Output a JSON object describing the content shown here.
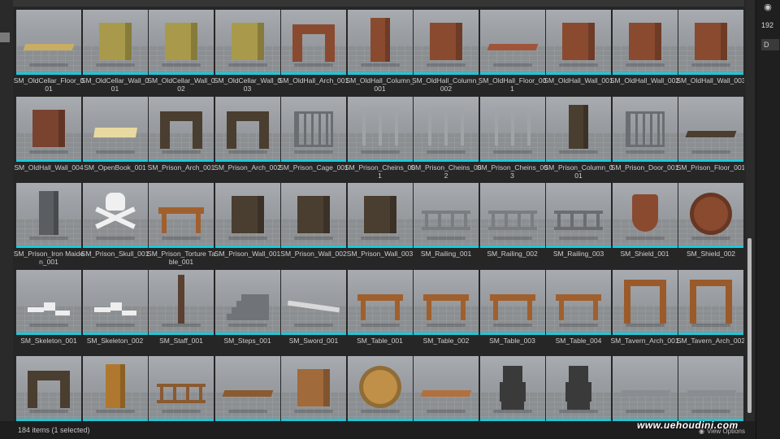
{
  "status": {
    "item_count": "184 items (1 selected)",
    "view_options": "View Options",
    "watermark": "www.uehoudini.com"
  },
  "side_panel": {
    "number": "192",
    "doc_label": "D",
    "visibility_icon": "eye-icon"
  },
  "colors": {
    "accent_cyan": "#19c9d9",
    "panel_bg": "#262626",
    "thumb_bg": "#9a9ea2"
  },
  "assets": [
    {
      "label": "SM_OldCellar_Floor_001",
      "kind": "floor",
      "color": "#c9ad63"
    },
    {
      "label": "SM_OldCellar_Wall_001",
      "kind": "block",
      "color": "#a89a4a"
    },
    {
      "label": "SM_OldCellar_Wall_002",
      "kind": "block",
      "color": "#a89a4a"
    },
    {
      "label": "SM_OldCellar_Wall_003",
      "kind": "block",
      "color": "#a89a4a"
    },
    {
      "label": "SM_OldHall_Arch_001",
      "kind": "arch",
      "color": "#8a4a30"
    },
    {
      "label": "SM_OldHall_Column_001",
      "kind": "column",
      "color": "#8a4a30"
    },
    {
      "label": "SM_OldHall_Column_002",
      "kind": "block",
      "color": "#8a4a30"
    },
    {
      "label": "SM_OldHall_Floor_001",
      "kind": "floor",
      "color": "#a0553a"
    },
    {
      "label": "SM_OldHall_Wall_001",
      "kind": "block",
      "color": "#8a4a30"
    },
    {
      "label": "SM_OldHall_Wall_002",
      "kind": "block",
      "color": "#8a4a30"
    },
    {
      "label": "SM_OldHall_Wall_003",
      "kind": "block",
      "color": "#8a4a30"
    },
    {
      "label": "SM_OldHall_Wall_004",
      "kind": "block",
      "color": "#7a4330"
    },
    {
      "label": "SM_OpenBook_001",
      "kind": "flat",
      "color": "#e8d9a0"
    },
    {
      "label": "SM_Prison_Arch_001",
      "kind": "arch",
      "color": "#4a3e30"
    },
    {
      "label": "SM_Prison_Arch_002",
      "kind": "arch",
      "color": "#4a3e30"
    },
    {
      "label": "SM_Prison_Cage_001",
      "kind": "cage",
      "color": "#6a6e72"
    },
    {
      "label": "SM_Prison_Cheins_001",
      "kind": "chains",
      "color": "#a0a4a8"
    },
    {
      "label": "SM_Prison_Cheins_002",
      "kind": "chains",
      "color": "#a0a4a8"
    },
    {
      "label": "SM_Prison_Cheins_003",
      "kind": "chains",
      "color": "#a0a4a8"
    },
    {
      "label": "SM_Prison_Column_001",
      "kind": "column",
      "color": "#4a3e30"
    },
    {
      "label": "SM_Prison_Door_001",
      "kind": "cage",
      "color": "#6a6e72"
    },
    {
      "label": "SM_Prison_Floor_001",
      "kind": "floor",
      "color": "#4a3e30"
    },
    {
      "label": "SM_Prison_Iron Maiden_001",
      "kind": "column",
      "color": "#5a5e62"
    },
    {
      "label": "SM_Prison_Skull_001",
      "kind": "skull",
      "color": "#f0f0f0"
    },
    {
      "label": "SM_Prison_Torture Table_001",
      "kind": "table",
      "color": "#a0602e"
    },
    {
      "label": "SM_Prison_Wall_001",
      "kind": "block",
      "color": "#4a3e30"
    },
    {
      "label": "SM_Prison_Wall_002",
      "kind": "block",
      "color": "#4a3e30"
    },
    {
      "label": "SM_Prison_Wall_003",
      "kind": "block",
      "color": "#4a3e30"
    },
    {
      "label": "SM_Railing_001",
      "kind": "railing",
      "color": "#7a7e82"
    },
    {
      "label": "SM_Railing_002",
      "kind": "railing",
      "color": "#7a7e82"
    },
    {
      "label": "SM_Railing_003",
      "kind": "railing",
      "color": "#6a6e72"
    },
    {
      "label": "SM_Shield_001",
      "kind": "shield",
      "color": "#8a4a30"
    },
    {
      "label": "SM_Shield_002",
      "kind": "round",
      "color": "#8a4a30"
    },
    {
      "label": "SM_Skeleton_001",
      "kind": "bones",
      "color": "#eeeeee"
    },
    {
      "label": "SM_Skeleton_002",
      "kind": "bones",
      "color": "#eeeeee"
    },
    {
      "label": "SM_Staff_001",
      "kind": "staff",
      "color": "#5a4030"
    },
    {
      "label": "SM_Steps_001",
      "kind": "steps",
      "color": "#707478"
    },
    {
      "label": "SM_Sword_001",
      "kind": "sword",
      "color": "#d8d8d8"
    },
    {
      "label": "SM_Table_001",
      "kind": "table",
      "color": "#a0602e"
    },
    {
      "label": "SM_Table_002",
      "kind": "table",
      "color": "#a0602e"
    },
    {
      "label": "SM_Table_003",
      "kind": "table",
      "color": "#a0602e"
    },
    {
      "label": "SM_Table_004",
      "kind": "table",
      "color": "#a0602e"
    },
    {
      "label": "SM_Tavern_Arch_001",
      "kind": "doorframe",
      "color": "#9a5a2a"
    },
    {
      "label": "SM_Tavern_Arch_002",
      "kind": "doorframe",
      "color": "#9a5a2a"
    },
    {
      "label": "",
      "kind": "arch",
      "color": "#4a3e30"
    },
    {
      "label": "",
      "kind": "column",
      "color": "#b0782e"
    },
    {
      "label": "",
      "kind": "railing",
      "color": "#8a5a30"
    },
    {
      "label": "",
      "kind": "floor",
      "color": "#8a5a30"
    },
    {
      "label": "",
      "kind": "block",
      "color": "#a06a3a"
    },
    {
      "label": "",
      "kind": "round",
      "color": "#c09048"
    },
    {
      "label": "",
      "kind": "floor",
      "color": "#b07040"
    },
    {
      "label": "",
      "kind": "figure",
      "color": "#3a3a3a"
    },
    {
      "label": "",
      "kind": "figure",
      "color": "#3a3a3a"
    },
    {
      "label": "",
      "kind": "floor",
      "color": "#8a8e92"
    },
    {
      "label": "",
      "kind": "floor",
      "color": "#8a8e92"
    }
  ]
}
